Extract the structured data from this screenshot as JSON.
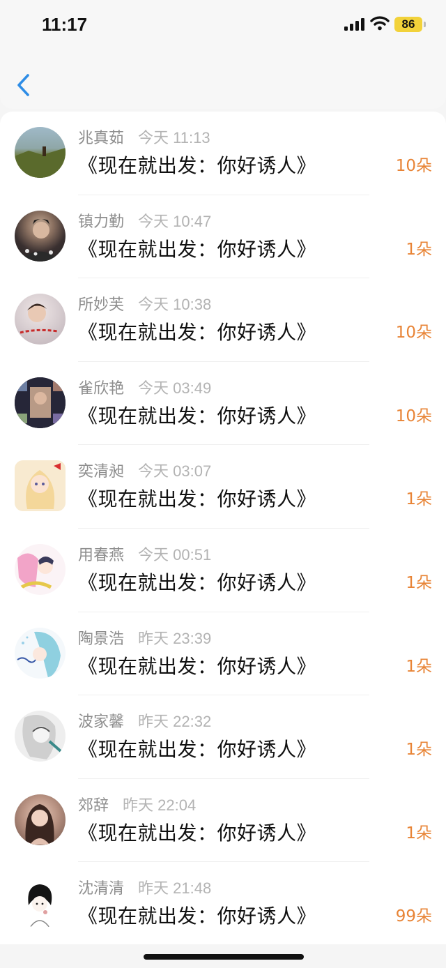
{
  "status_bar": {
    "time": "11:17",
    "battery": "86"
  },
  "nav": {
    "back_icon": "chevron-left-icon"
  },
  "colors": {
    "accent": "#2e8de6",
    "count": "#e88436",
    "battery": "#f2d23a"
  },
  "messages": [
    {
      "sender": "兆真茹",
      "time": "今天 11:13",
      "title": "《现在就出发：你好诱人》",
      "count": "10朵"
    },
    {
      "sender": "镇力勤",
      "time": "今天 10:47",
      "title": "《现在就出发：你好诱人》",
      "count": "1朵"
    },
    {
      "sender": "所妙芙",
      "time": "今天 10:38",
      "title": "《现在就出发：你好诱人》",
      "count": "10朵"
    },
    {
      "sender": "雀欣艳",
      "time": "今天 03:49",
      "title": "《现在就出发：你好诱人》",
      "count": "10朵"
    },
    {
      "sender": "奕清昶",
      "time": "今天 03:07",
      "title": "《现在就出发：你好诱人》",
      "count": "1朵"
    },
    {
      "sender": "用春燕",
      "time": "今天 00:51",
      "title": "《现在就出发：你好诱人》",
      "count": "1朵"
    },
    {
      "sender": "陶景浩",
      "time": "昨天 23:39",
      "title": "《现在就出发：你好诱人》",
      "count": "1朵"
    },
    {
      "sender": "波家馨",
      "time": "昨天 22:32",
      "title": "《现在就出发：你好诱人》",
      "count": "1朵"
    },
    {
      "sender": "郊辞",
      "time": "昨天 22:04",
      "title": "《现在就出发：你好诱人》",
      "count": "1朵"
    },
    {
      "sender": "沈清清",
      "time": "昨天 21:48",
      "title": "《现在就出发：你好诱人》",
      "count": "99朵"
    }
  ]
}
